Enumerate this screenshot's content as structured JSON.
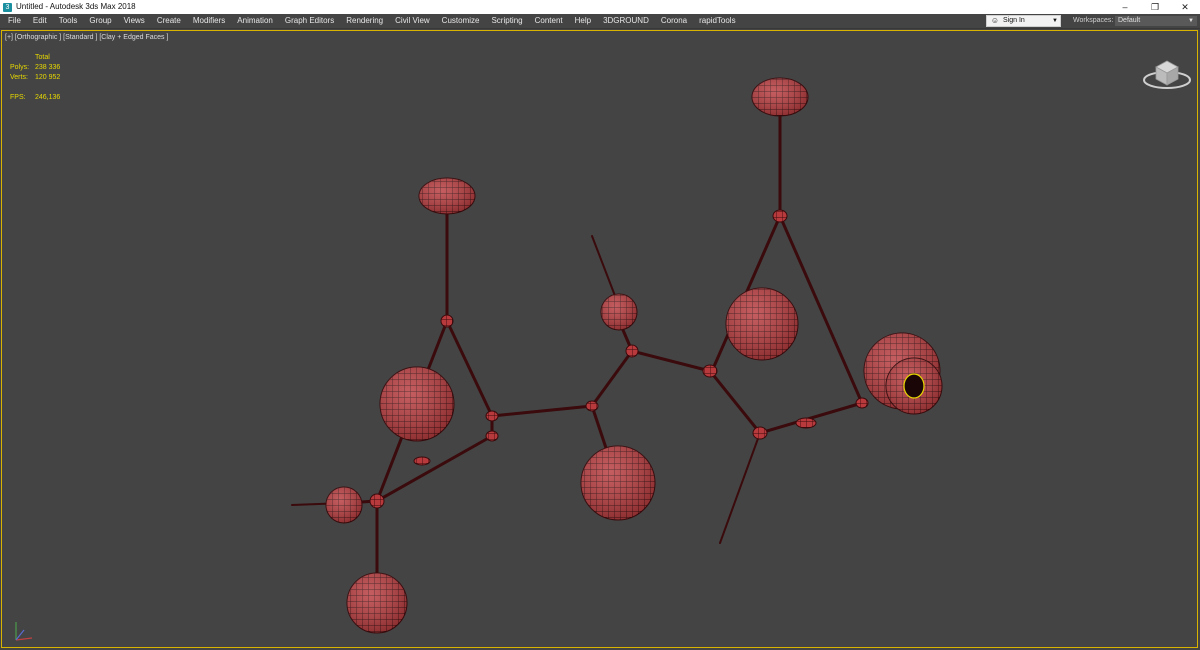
{
  "window": {
    "title": "Untitled - Autodesk 3ds Max 2018",
    "controls": [
      "–",
      "❐",
      "✕"
    ]
  },
  "menu": {
    "items": [
      "File",
      "Edit",
      "Tools",
      "Group",
      "Views",
      "Create",
      "Modifiers",
      "Animation",
      "Graph Editors",
      "Rendering",
      "Civil View",
      "Customize",
      "Scripting",
      "Content",
      "Help",
      "3DGROUND",
      "Corona",
      "rapidTools"
    ]
  },
  "account": {
    "signin_label": "Sign In",
    "workspaces_label": "Workspaces:",
    "workspace_value": "Default"
  },
  "viewport": {
    "label": "[+] [Orthographic ] [Standard ] [Clay + Edged Faces ]",
    "stats": {
      "header": "Total",
      "polys_label": "Polys:",
      "polys_value": "238 336",
      "verts_label": "Verts:",
      "verts_value": "120 952",
      "fps_label": "FPS:",
      "fps_value": "246,136"
    }
  },
  "colors": {
    "mesh": "#b83a3d",
    "wire": "#3a0a0c",
    "viewport_border": "#d8b300",
    "stats_text": "#e8d900"
  },
  "icons": {
    "viewcube": "viewcube-icon",
    "axis": "axis-tripod-icon",
    "user": "user-icon"
  }
}
